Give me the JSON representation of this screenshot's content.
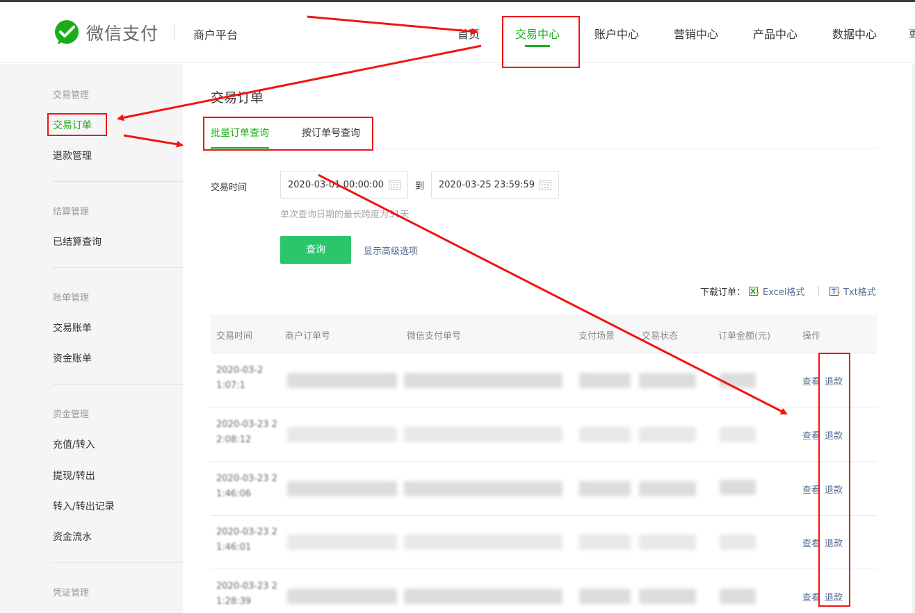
{
  "header": {
    "brand": "微信支付",
    "platform": "商户平台",
    "nav": [
      "首页",
      "交易中心",
      "账户中心",
      "营销中心",
      "产品中心",
      "数据中心"
    ],
    "active_nav": "交易中心",
    "edge_text": "更"
  },
  "sidebar": {
    "groups": [
      {
        "title": "交易管理",
        "items": [
          "交易订单",
          "退款管理"
        ]
      },
      {
        "title": "结算管理",
        "items": [
          "已结算查询"
        ]
      },
      {
        "title": "账单管理",
        "items": [
          "交易账单",
          "资金账单"
        ]
      },
      {
        "title": "资金管理",
        "items": [
          "充值/转入",
          "提现/转出",
          "转入/转出记录",
          "资金流水"
        ]
      },
      {
        "title": "凭证管理",
        "items": []
      }
    ],
    "active_item": "交易订单"
  },
  "main": {
    "title": "交易订单",
    "tabs": [
      "批量订单查询",
      "按订单号查询"
    ],
    "active_tab": "批量订单查询",
    "form": {
      "time_label": "交易时间",
      "start": "2020-03-01 00:00:00",
      "to": "到",
      "end": "2020-03-25 23:59:59",
      "hint": "单次查询日期的最长跨度为31天",
      "query_button": "查询",
      "advanced_link": "显示高级选项"
    },
    "download": {
      "label": "下载订单：",
      "excel": "Excel格式",
      "separator": "|",
      "txt": "Txt格式"
    },
    "table": {
      "columns": [
        "交易时间",
        "商户订单号",
        "微信支付单号",
        "支付场景",
        "交易状态",
        "订单金额(元)",
        "操作"
      ],
      "rows": [
        {
          "time_line1": "2020-03-2",
          "time_line2": "1:07:1",
          "view": "查看",
          "refund": "退款"
        },
        {
          "time_line1": "2020-03-23 2",
          "time_line2": "2:08:12",
          "view": "查看",
          "refund": "退款"
        },
        {
          "time_line1": "2020-03-23 2",
          "time_line2": "1:46:06",
          "view": "查看",
          "refund": "退款"
        },
        {
          "time_line1": "2020-03-23 2",
          "time_line2": "1:46:01",
          "view": "查看",
          "refund": "退款"
        },
        {
          "time_line1": "2020-03-23 2",
          "time_line2": "1:28:39",
          "view": "查看",
          "refund": "退款"
        }
      ]
    }
  },
  "colors": {
    "brand_green": "#1aad19",
    "button_green": "#2bc66b",
    "link_blue": "#576b95",
    "annotation_red": "#f0150e"
  },
  "icons": [
    "wechat-pay-logo",
    "calendar-icon",
    "excel-icon",
    "txt-icon"
  ]
}
